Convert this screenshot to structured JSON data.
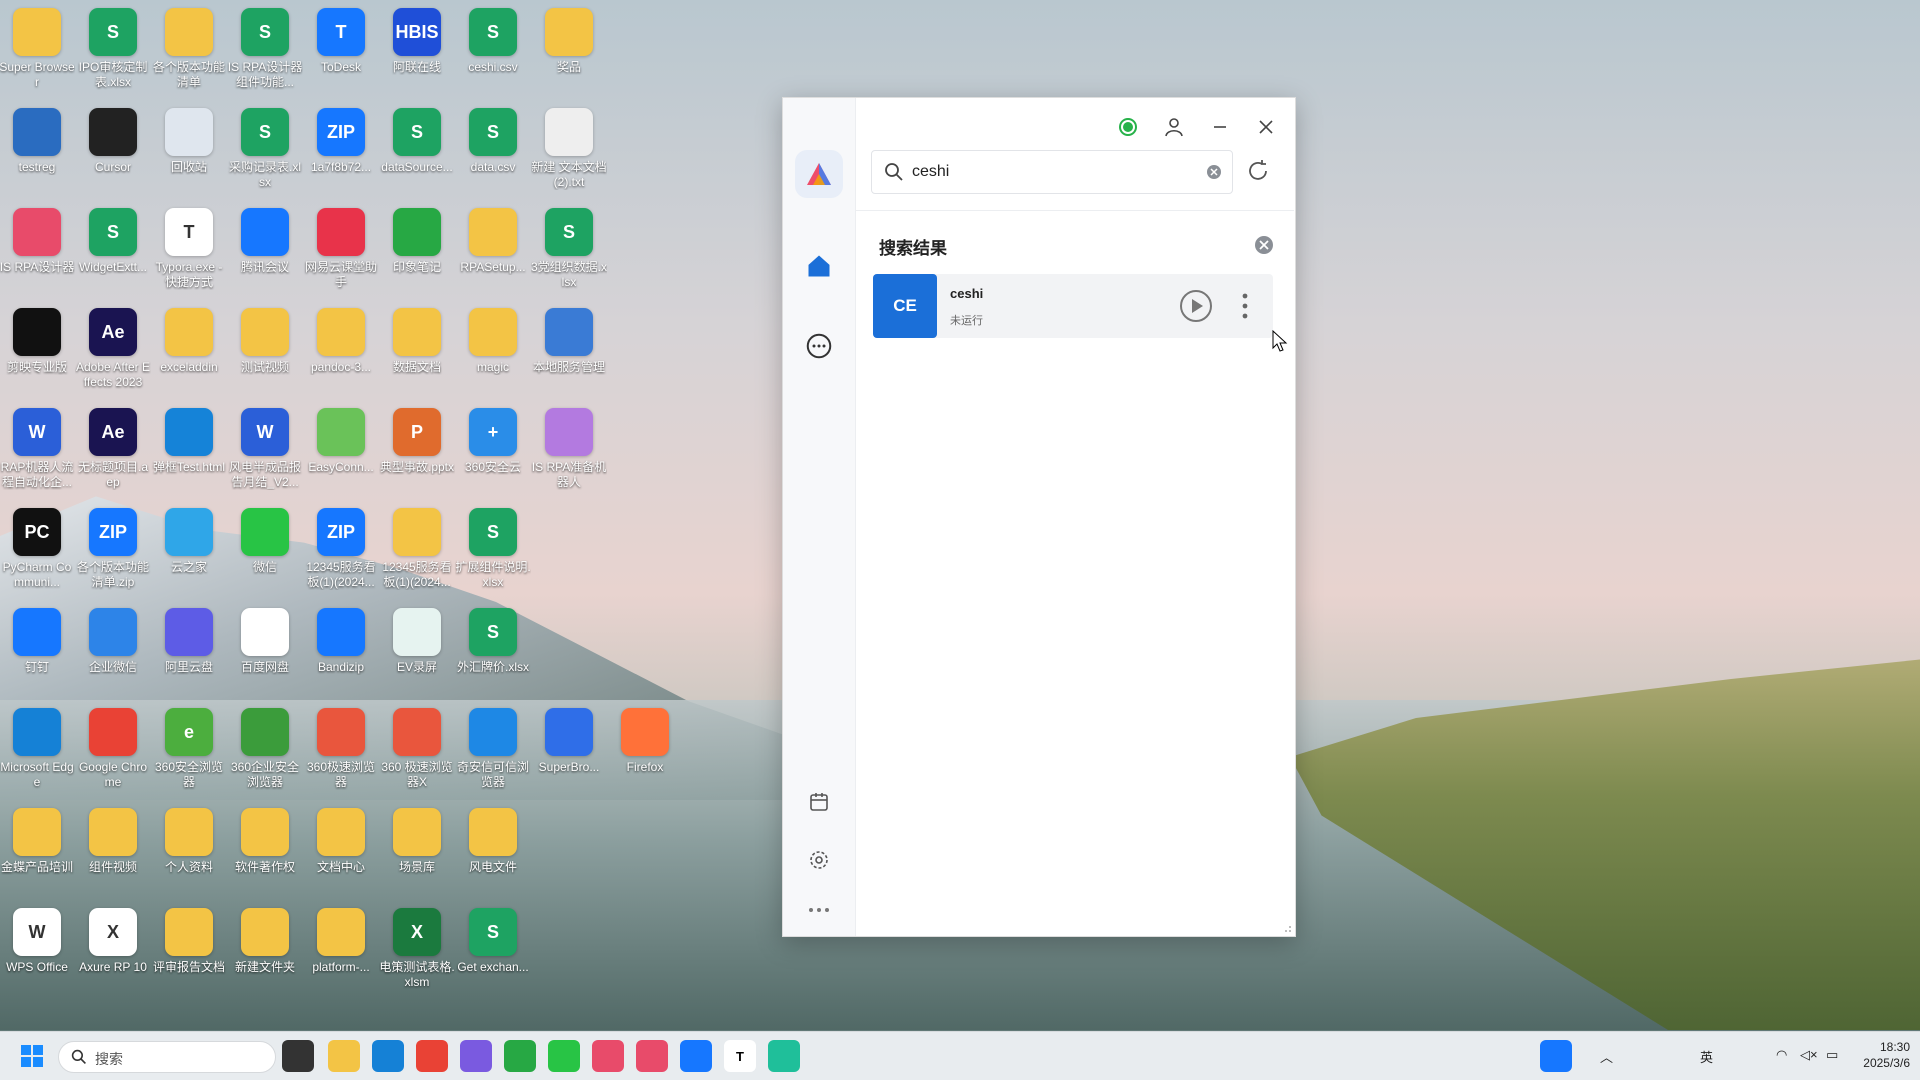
{
  "desktop": {
    "icons": [
      {
        "label": "Super Browser",
        "color": "#f3c445",
        "glyph": ""
      },
      {
        "label": "IPO审核定制表.xlsx",
        "color": "#1ea362",
        "glyph": "S"
      },
      {
        "label": "各个版本功能清单",
        "color": "#f3c445",
        "glyph": ""
      },
      {
        "label": "IS RPA设计器组件功能...",
        "color": "#1ea362",
        "glyph": "S"
      },
      {
        "label": "ToDesk",
        "color": "#1677ff",
        "glyph": "T"
      },
      {
        "label": "阿联在线",
        "color": "#1f4fd8",
        "glyph": "HBIS"
      },
      {
        "label": "ceshi.csv",
        "color": "#1ea362",
        "glyph": "S"
      },
      {
        "label": "奖品",
        "color": "#f3c445",
        "glyph": ""
      },
      {
        "label": "testreg",
        "color": "#2a6cc0",
        "glyph": ""
      },
      {
        "label": "Cursor",
        "color": "#222222",
        "glyph": ""
      },
      {
        "label": "回收站",
        "color": "#dfe6ee",
        "glyph": ""
      },
      {
        "label": "采购记录表.xlsx",
        "color": "#1ea362",
        "glyph": "S"
      },
      {
        "label": "1a7f8b72...",
        "color": "#1677ff",
        "glyph": "ZIP"
      },
      {
        "label": "dataSource...",
        "color": "#1ea362",
        "glyph": "S"
      },
      {
        "label": "data.csv",
        "color": "#1ea362",
        "glyph": "S"
      },
      {
        "label": "新建 文本文档 (2).txt",
        "color": "#eeeeee",
        "glyph": ""
      },
      {
        "label": "IS RPA设计器",
        "color": "#e84b6a",
        "glyph": ""
      },
      {
        "label": "WidgetExtt...",
        "color": "#1ea362",
        "glyph": "S"
      },
      {
        "label": "Typora.exe - 快捷方式",
        "color": "#ffffff",
        "glyph": "T"
      },
      {
        "label": "腾讯会议",
        "color": "#1677ff",
        "glyph": ""
      },
      {
        "label": "网易云课堂助手",
        "color": "#e8334a",
        "glyph": ""
      },
      {
        "label": "印象笔记",
        "color": "#27a844",
        "glyph": ""
      },
      {
        "label": "RPASetup...",
        "color": "#f3c445",
        "glyph": ""
      },
      {
        "label": "3党组织数据.xlsx",
        "color": "#1ea362",
        "glyph": "S"
      },
      {
        "label": "剪映专业版",
        "color": "#111111",
        "glyph": ""
      },
      {
        "label": "Adobe After Effects 2023",
        "color": "#1a1451",
        "glyph": "Ae"
      },
      {
        "label": "exceladdin",
        "color": "#f3c445",
        "glyph": ""
      },
      {
        "label": "测试视频",
        "color": "#f3c445",
        "glyph": ""
      },
      {
        "label": "pandoc-3...",
        "color": "#f3c445",
        "glyph": ""
      },
      {
        "label": "数据文档",
        "color": "#f3c445",
        "glyph": ""
      },
      {
        "label": "magic",
        "color": "#f3c445",
        "glyph": ""
      },
      {
        "label": "本地服务管理",
        "color": "#3a7bd5",
        "glyph": ""
      },
      {
        "label": "RAP机器人流程自动化企...",
        "color": "#2b5fd8",
        "glyph": "W"
      },
      {
        "label": "无标题项目.aep",
        "color": "#1a1451",
        "glyph": "Ae"
      },
      {
        "label": "弹框Test.html",
        "color": "#1583d8",
        "glyph": ""
      },
      {
        "label": "风电半成品报告月结_V2...",
        "color": "#2b5fd8",
        "glyph": "W"
      },
      {
        "label": "EasyConn...",
        "color": "#6ac259",
        "glyph": ""
      },
      {
        "label": "典型事故.pptx",
        "color": "#e06b2d",
        "glyph": "P"
      },
      {
        "label": "360安全云",
        "color": "#2a8de8",
        "glyph": "+"
      },
      {
        "label": "IS RPA准备机器人",
        "color": "#b37ae0",
        "glyph": ""
      },
      {
        "label": "PyCharm Communi...",
        "color": "#111111",
        "glyph": "PC"
      },
      {
        "label": "各个版本功能清单.zip",
        "color": "#1677ff",
        "glyph": "ZIP"
      },
      {
        "label": "云之家",
        "color": "#2fa6e8",
        "glyph": ""
      },
      {
        "label": "微信",
        "color": "#28c445",
        "glyph": ""
      },
      {
        "label": "12345服务看板(1)(2024...",
        "color": "#1677ff",
        "glyph": "ZIP"
      },
      {
        "label": "12345服务看板(1)(2024...",
        "color": "#f3c445",
        "glyph": ""
      },
      {
        "label": "扩展组件说明.xlsx",
        "color": "#1ea362",
        "glyph": "S"
      },
      {
        "label": "",
        "color": "",
        "glyph": ""
      },
      {
        "label": "钉钉",
        "color": "#1677ff",
        "glyph": ""
      },
      {
        "label": "企业微信",
        "color": "#2d84e8",
        "glyph": ""
      },
      {
        "label": "阿里云盘",
        "color": "#5d5ce6",
        "glyph": ""
      },
      {
        "label": "百度网盘",
        "color": "#ffffff",
        "glyph": ""
      },
      {
        "label": "Bandizip",
        "color": "#1677ff",
        "glyph": ""
      },
      {
        "label": "EV录屏",
        "color": "#e6f3f0",
        "glyph": ""
      },
      {
        "label": "外汇牌价.xlsx",
        "color": "#1ea362",
        "glyph": "S"
      },
      {
        "label": "",
        "color": "",
        "glyph": ""
      },
      {
        "label": "Microsoft Edge",
        "color": "#1581d6",
        "glyph": ""
      },
      {
        "label": "Google Chrome",
        "color": "#e94235",
        "glyph": ""
      },
      {
        "label": "360安全浏览器",
        "color": "#4cae3e",
        "glyph": "e"
      },
      {
        "label": "360企业安全浏览器",
        "color": "#3b9c3b",
        "glyph": ""
      },
      {
        "label": "360极速浏览器",
        "color": "#e9563d",
        "glyph": ""
      },
      {
        "label": "360 极速浏览器X",
        "color": "#e9563d",
        "glyph": ""
      },
      {
        "label": "奇安信可信浏览器",
        "color": "#1e88e5",
        "glyph": ""
      },
      {
        "label": "SuperBro...",
        "color": "#2f6ee8",
        "glyph": ""
      },
      {
        "label": "Firefox",
        "color": "#ff7139",
        "glyph": ""
      },
      {
        "label": "金蝶产品培训",
        "color": "#f3c445",
        "glyph": ""
      },
      {
        "label": "组件视频",
        "color": "#f3c445",
        "glyph": ""
      },
      {
        "label": "个人资料",
        "color": "#f3c445",
        "glyph": ""
      },
      {
        "label": "软件著作权",
        "color": "#f3c445",
        "glyph": ""
      },
      {
        "label": "文档中心",
        "color": "#f3c445",
        "glyph": ""
      },
      {
        "label": "场景库",
        "color": "#f3c445",
        "glyph": ""
      },
      {
        "label": "风电文件",
        "color": "#f3c445",
        "glyph": ""
      },
      {
        "label": "WPS Office",
        "color": "#ffffff",
        "glyph": "W"
      },
      {
        "label": "Axure RP 10",
        "color": "#ffffff",
        "glyph": "X"
      },
      {
        "label": "评审报告文档",
        "color": "#f3c445",
        "glyph": ""
      },
      {
        "label": "新建文件夹",
        "color": "#f3c445",
        "glyph": ""
      },
      {
        "label": "platform-...",
        "color": "#f3c445",
        "glyph": ""
      },
      {
        "label": "电策测试表格.xlsm",
        "color": "#1b7a3e",
        "glyph": "X"
      },
      {
        "label": "Get exchan...",
        "color": "#1ea362",
        "glyph": "S"
      }
    ]
  },
  "app": {
    "search": {
      "value": "ceshi",
      "placeholder": ""
    },
    "results_title": "搜索结果",
    "result": {
      "avatar": "CE",
      "name": "ceshi",
      "status": "未运行"
    },
    "accent": "#1b6fd8",
    "status_dot": "#27b24a"
  },
  "taskbar": {
    "search_placeholder": "搜索",
    "ime": "英",
    "time": "18:30",
    "date": "2025/3/6"
  }
}
